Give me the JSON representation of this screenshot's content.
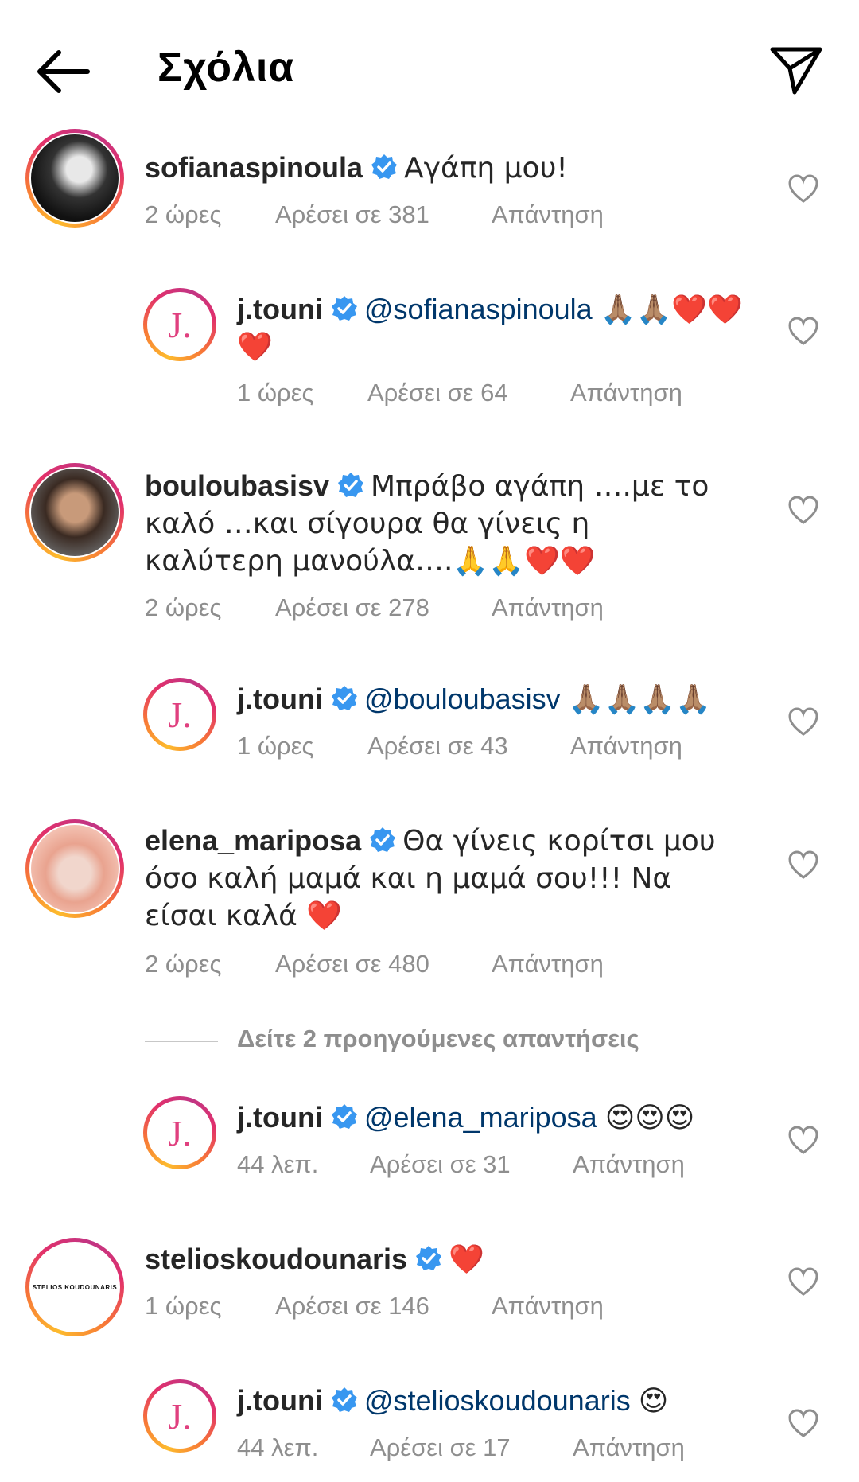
{
  "header": {
    "title": "Σχόλια",
    "back_icon": "arrow-left-icon",
    "share_icon": "paper-plane-icon"
  },
  "comments": [
    {
      "username": "sofianaspinoula",
      "text": "Αγάπη μου!",
      "time": "2 ώρες",
      "likes": "Αρέσει σε 381",
      "reply": "Απάντηση",
      "replies": [
        {
          "username": "j.touni",
          "mention": "@sofianaspinoula",
          "text": "🙏🏽🙏🏽❤️❤️❤️",
          "time": "1 ώρες",
          "likes": "Αρέσει σε 64",
          "reply": "Απάντηση"
        }
      ]
    },
    {
      "username": "bouloubasisv",
      "text": "Μπράβο αγάπη ….με το καλό …και σίγουρα θα γίνεις η καλύτερη μανούλα….🙏🙏❤️❤️",
      "time": "2 ώρες",
      "likes": "Αρέσει σε 278",
      "reply": "Απάντηση",
      "replies": [
        {
          "username": "j.touni",
          "mention": "@bouloubasisv",
          "text": "🙏🏽🙏🏽🙏🏽🙏🏽",
          "time": "1 ώρες",
          "likes": "Αρέσει σε 43",
          "reply": "Απάντηση"
        }
      ]
    },
    {
      "username": "elena_mariposa",
      "text": "Θα γίνεις κορίτσι μου όσο καλή μαμά και η μαμά σου!!! Να είσαι καλά ❤️",
      "time": "2 ώρες",
      "likes": "Αρέσει σε 480",
      "reply": "Απάντηση",
      "see_more": "Δείτε 2 προηγούμενες απαντήσεις",
      "replies": [
        {
          "username": "j.touni",
          "mention": "@elena_mariposa",
          "text": "😍😍😍",
          "time": "44 λεπ.",
          "likes": "Αρέσει σε 31",
          "reply": "Απάντηση"
        }
      ]
    },
    {
      "username": "stelioskoudounaris",
      "text": "❤️",
      "avatar_text": "STELIOS KOUDOUNARIS",
      "time": "1 ώρες",
      "likes": "Αρέσει σε 146",
      "reply": "Απάντηση",
      "replies": [
        {
          "username": "j.touni",
          "mention": "@stelioskoudounaris",
          "text": "😍",
          "time": "44 λεπ.",
          "likes": "Αρέσει σε 17",
          "reply": "Απάντηση"
        }
      ]
    }
  ],
  "avatar_letter": "J.",
  "colors": {
    "mention": "#00376b",
    "meta": "#8e8e8e",
    "text": "#262626",
    "verified": "#3897f0"
  }
}
